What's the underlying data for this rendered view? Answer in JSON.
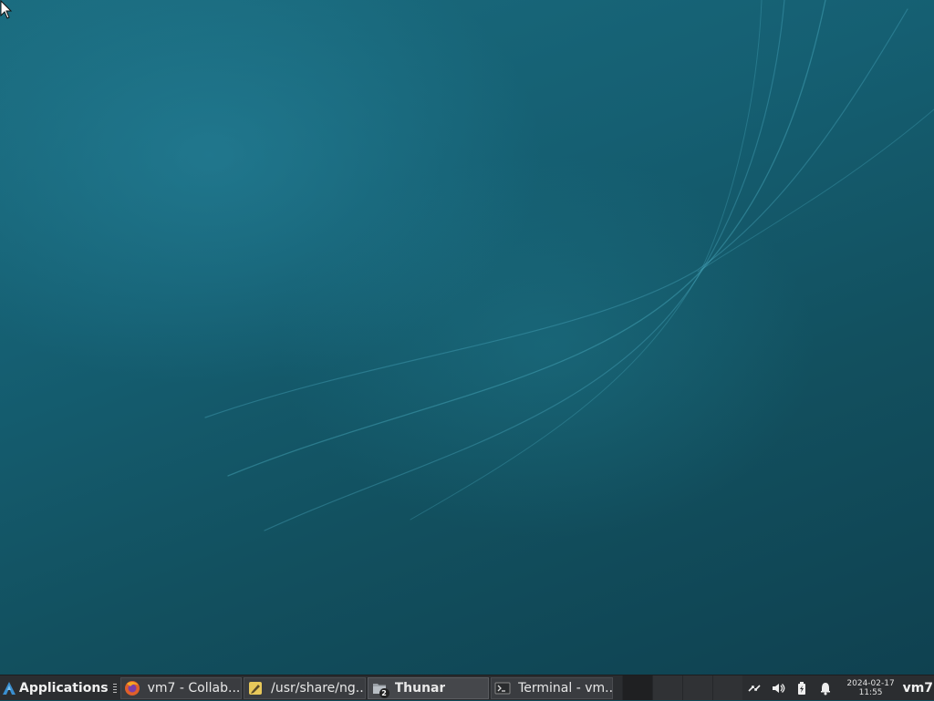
{
  "panel": {
    "app_menu_label": "Applications",
    "tasks": [
      {
        "label": "vm7 - Collab...",
        "icon": "firefox-icon",
        "active": false
      },
      {
        "label": "/usr/share/ng...",
        "icon": "text-editor-icon",
        "active": false
      },
      {
        "label": "Thunar",
        "icon": "folder-icon",
        "active": true,
        "badge": "2"
      },
      {
        "label": "Terminal - vm...",
        "icon": "terminal-icon",
        "active": false
      }
    ],
    "clock_date": "2024-02-17",
    "clock_time": "11:55",
    "hostname": "vm7"
  },
  "colors": {
    "panel_bg": "#2b2d30",
    "desktop_bg": "#155f72"
  }
}
